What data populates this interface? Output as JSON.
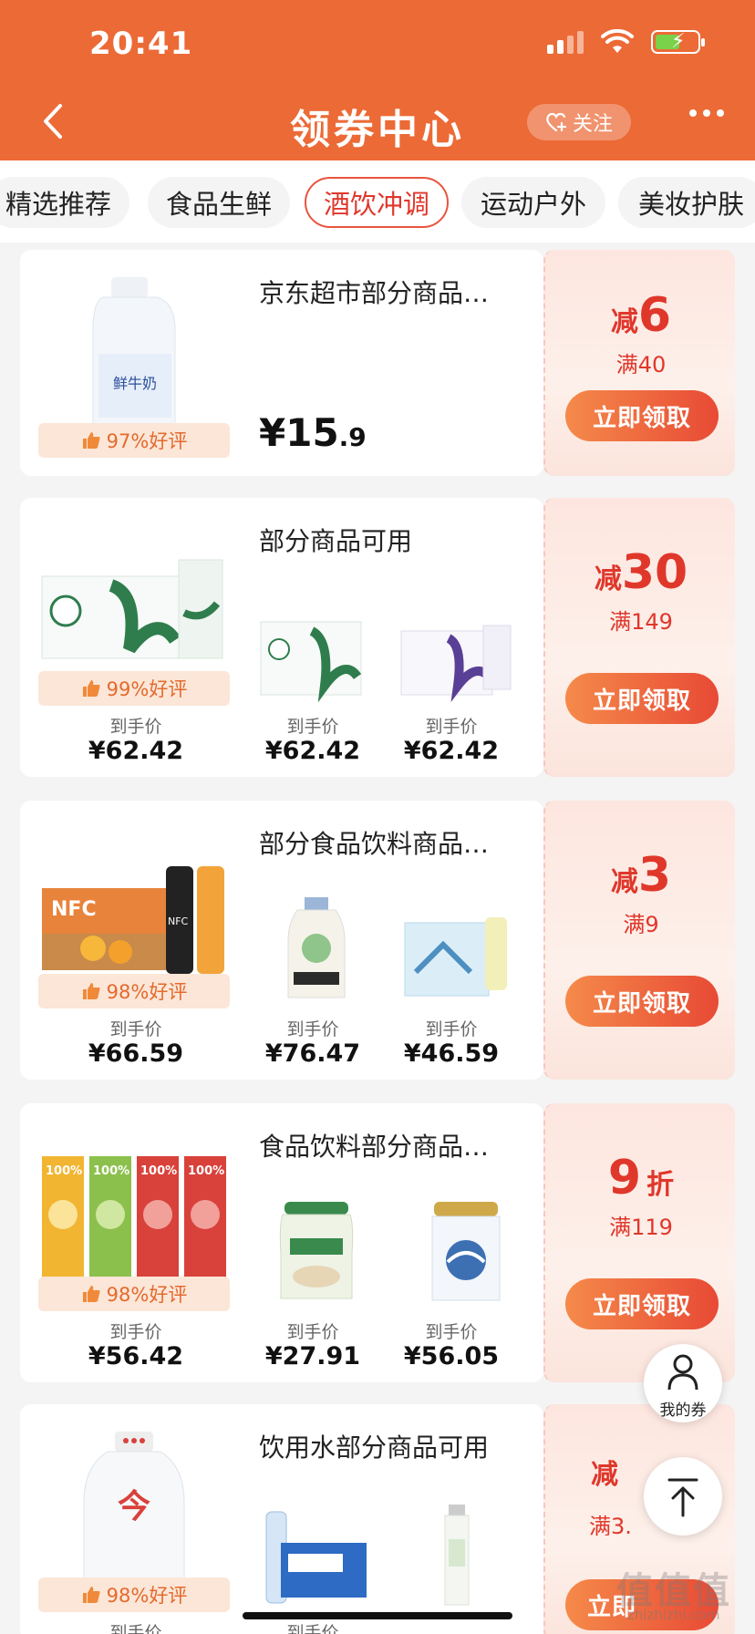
{
  "status": {
    "time": "20:41"
  },
  "header": {
    "title": "领券中心",
    "follow_label": "关注"
  },
  "tabs": [
    {
      "label": "精选推荐",
      "active": false
    },
    {
      "label": "食品生鲜",
      "active": false
    },
    {
      "label": "酒饮冲调",
      "active": true
    },
    {
      "label": "运动户外",
      "active": false
    },
    {
      "label": "美妆护肤",
      "active": false
    }
  ],
  "cards": [
    {
      "title": "京东超市部分商品…",
      "rating": "97%好评",
      "price_main": "¥15",
      "price_decimal": ".9",
      "coupon": {
        "prefix": "减",
        "amount": "6",
        "suffix": "",
        "condition": "满40",
        "button": "立即领取"
      }
    },
    {
      "title": "部分商品可用",
      "rating": "99%好评",
      "prices": [
        {
          "label": "到手价",
          "value": "¥62.42"
        },
        {
          "label": "到手价",
          "value": "¥62.42"
        },
        {
          "label": "到手价",
          "value": "¥62.42"
        }
      ],
      "coupon": {
        "prefix": "减",
        "amount": "30",
        "suffix": "",
        "condition": "满149",
        "button": "立即领取"
      }
    },
    {
      "title": "部分食品饮料商品…",
      "rating": "98%好评",
      "prices": [
        {
          "label": "到手价",
          "value": "¥66.59"
        },
        {
          "label": "到手价",
          "value": "¥76.47"
        },
        {
          "label": "到手价",
          "value": "¥46.59"
        }
      ],
      "coupon": {
        "prefix": "减",
        "amount": "3",
        "suffix": "",
        "condition": "满9",
        "button": "立即领取"
      }
    },
    {
      "title": "食品饮料部分商品…",
      "rating": "98%好评",
      "prices": [
        {
          "label": "到手价",
          "value": "¥56.42"
        },
        {
          "label": "到手价",
          "value": "¥27.91"
        },
        {
          "label": "到手价",
          "value": "¥56.05"
        }
      ],
      "coupon": {
        "prefix": "",
        "amount": "9",
        "suffix": "折",
        "condition": "满119",
        "button": "立即领取"
      }
    },
    {
      "title": "饮用水部分商品可用",
      "rating": "98%好评",
      "prices": [
        {
          "label": "到手价",
          "value": ""
        },
        {
          "label": "到手价",
          "value": ""
        },
        {
          "label": "",
          "value": ""
        }
      ],
      "coupon": {
        "prefix": "减",
        "amount": "",
        "suffix": "",
        "condition": "满3.",
        "button": "立即"
      }
    }
  ],
  "floating": {
    "my_coupon_label": "我的券"
  },
  "watermark": {
    "main": "值值值",
    "sub": "zhizhizhi.com"
  },
  "colors": {
    "header_bg": "#ec6a36",
    "accent_red": "#e0372b",
    "button_gradient_start": "#f58a4a",
    "button_gradient_end": "#e84a35"
  }
}
